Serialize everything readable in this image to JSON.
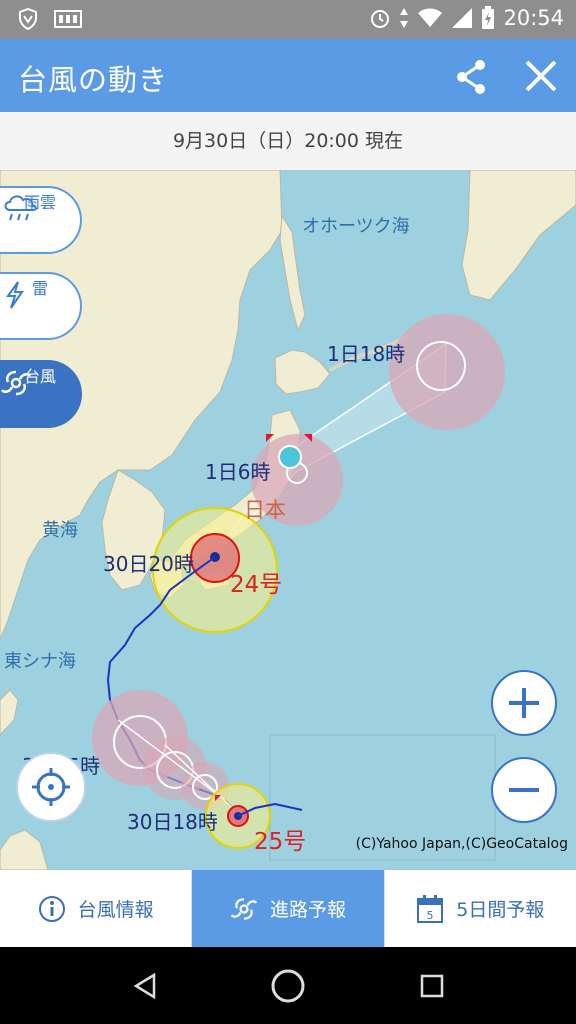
{
  "status_bar": {
    "time": "20:54"
  },
  "app_bar": {
    "title": "台風の動き"
  },
  "date_bar": {
    "text": "9月30日（日）20:00 現在"
  },
  "side_buttons": [
    {
      "label": "雨雲",
      "icon": "rain-cloud-icon"
    },
    {
      "label": "雷",
      "icon": "lightning-icon"
    },
    {
      "label": "台風",
      "icon": "typhoon-icon",
      "active": true
    }
  ],
  "map": {
    "seas": [
      "オホーツク海",
      "黄海",
      "東シナ海"
    ],
    "land_label": "日本",
    "time_labels": [
      "1日18時",
      "1日6時",
      "30日20時",
      "3日15時",
      "30日18時"
    ],
    "typhoons": [
      "24号",
      "25号"
    ],
    "copyright": "(C)Yahoo Japan,(C)GeoCatalog"
  },
  "tabs": [
    {
      "label": "台風情報",
      "icon": "info-icon"
    },
    {
      "label": "進路予報",
      "icon": "typhoon-icon",
      "active": true
    },
    {
      "label": "5日間予報",
      "icon": "calendar-icon",
      "calendar_day": "5"
    }
  ]
}
